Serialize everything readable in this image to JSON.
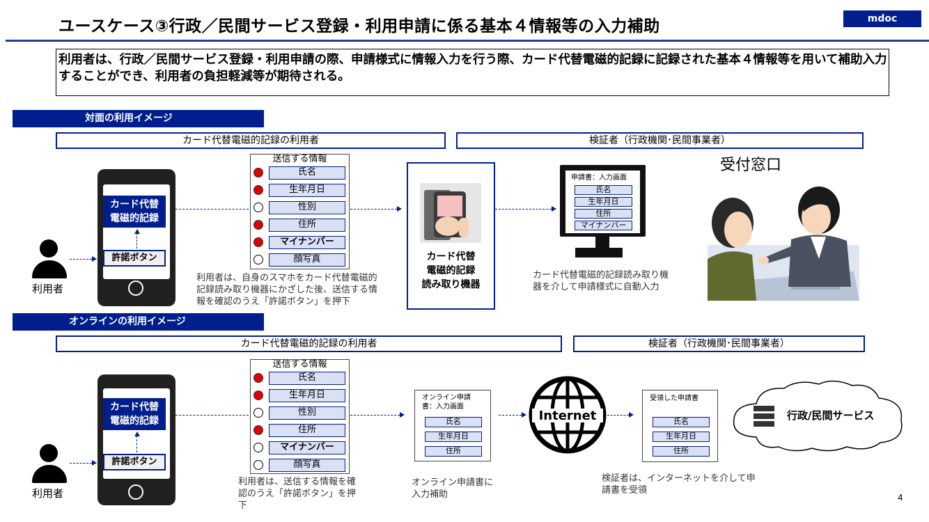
{
  "page": {
    "title": "ユースケース③行政／民間サービス登録・利用申請に係る基本４情報等の入力補助",
    "badge": "mdoc",
    "summary": "利用者は、行政／民間サービス登録・利用申請の際、申請様式に情報入力を行う際、カード代替電磁的記録に記録された基本４情報等を用いて補助入力することができ、利用者の負担軽減等が期待される。",
    "page_number": "4"
  },
  "section1": {
    "label": "対面の利用イメージ",
    "user_header": "カード代替電磁的記録の利用者",
    "verifier_header": "検証者（行政機関･民間事業者）",
    "user_label": "利用者",
    "phone": {
      "card_line1": "カード代替",
      "card_line2": "電磁的記録",
      "permit_button": "許諾ボタン"
    },
    "info": {
      "title": "送信する情報",
      "items": [
        {
          "label": "氏名",
          "selected": true
        },
        {
          "label": "生年月日",
          "selected": true
        },
        {
          "label": "性別",
          "selected": false
        },
        {
          "label": "住所",
          "selected": true
        },
        {
          "label": "マイナンバー",
          "selected": true
        },
        {
          "label": "顔写真",
          "selected": false
        }
      ]
    },
    "info_caption_l1": "利用者は、自身のスマホをカード代替電磁的",
    "info_caption_l2": "記録読み取り機器にかざした後、送信する情",
    "info_caption_l3": "報を確認のうえ「許諾ボタン」を押下",
    "reader": {
      "line1": "カード代替",
      "line2": "電磁的記録",
      "line3": "読み取り機器"
    },
    "monitor": {
      "title": "申請書：入力画面",
      "fields": [
        "氏名",
        "生年月日",
        "住所",
        "マイナンバー"
      ]
    },
    "monitor_caption_l1": "カード代替電磁的記録読み取り機",
    "monitor_caption_l2": "器を介して申請様式に自動入力",
    "counter_label": "受付窓口"
  },
  "section2": {
    "label": "オンラインの利用イメージ",
    "user_header": "カード代替電磁的記録の利用者",
    "verifier_header": "検証者（行政機関･民間事業者）",
    "user_label": "利用者",
    "phone": {
      "card_line1": "カード代替",
      "card_line2": "電磁的記録",
      "permit_button": "許諾ボタン"
    },
    "info": {
      "title": "送信する情報",
      "items": [
        {
          "label": "氏名",
          "selected": true
        },
        {
          "label": "生年月日",
          "selected": true
        },
        {
          "label": "性別",
          "selected": false
        },
        {
          "label": "住所",
          "selected": true
        },
        {
          "label": "マイナンバー",
          "selected": false
        },
        {
          "label": "顔写真",
          "selected": false
        }
      ]
    },
    "info_caption_l1": "利用者は、送信する情報を確",
    "info_caption_l2": "認のうえ「許諾ボタン」を押",
    "info_caption_l3": "下",
    "online_form": {
      "title_l1": "オンライン申請",
      "title_l2": "書：入力画面",
      "fields": [
        "氏名",
        "生年月日",
        "住所"
      ]
    },
    "online_caption_l1": "オンライン申請書に",
    "online_caption_l2": "入力補助",
    "internet_label": "Internet",
    "received_form": {
      "title": "受領した申請書",
      "fields": [
        "氏名",
        "生年月日",
        "住所"
      ]
    },
    "received_caption_l1": "検証者は、インターネットを介して申",
    "received_caption_l2": "請書を受領",
    "cloud_label": "行政/民間サービス"
  },
  "colors": {
    "navy": "#001e8c",
    "field_fill": "#dbe1f5",
    "red_dot": "#e00000"
  }
}
